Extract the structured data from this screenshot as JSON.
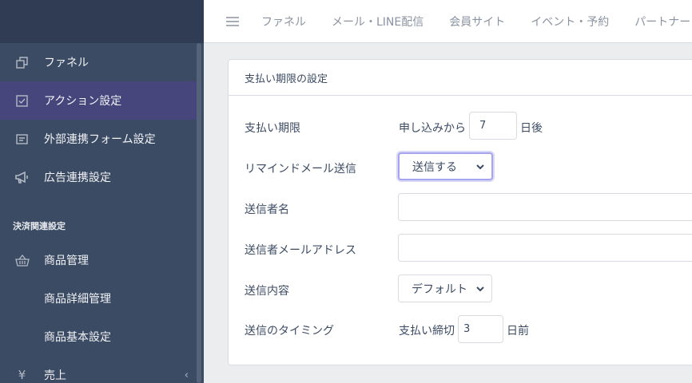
{
  "header": {
    "nav": [
      "ファネル",
      "メール・LINE配信",
      "会員サイト",
      "イベント・予約",
      "パートナー"
    ]
  },
  "sidebar": {
    "items": [
      {
        "label": "ファネル"
      },
      {
        "label": "アクション設定"
      },
      {
        "label": "外部連携フォーム設定"
      },
      {
        "label": "広告連携設定"
      }
    ],
    "section_title": "決済関連設定",
    "payment_items": [
      {
        "label": "商品管理"
      },
      {
        "label": "商品詳細管理"
      },
      {
        "label": "商品基本設定"
      },
      {
        "label": "売上"
      }
    ]
  },
  "card": {
    "title": "支払い期限の設定",
    "deadline": {
      "label": "支払い期限",
      "prefix": "申し込みから",
      "value": "7",
      "suffix": "日後"
    },
    "remind": {
      "label": "リマインドメール送信",
      "selected": "送信する"
    },
    "sender_name": {
      "label": "送信者名",
      "value": ""
    },
    "sender_email": {
      "label": "送信者メールアドレス",
      "value": ""
    },
    "content": {
      "label": "送信内容",
      "selected": "デフォルト"
    },
    "timing": {
      "label": "送信のタイミング",
      "prefix": "支払い締切",
      "value": "3",
      "suffix": "日前"
    }
  },
  "colors": {
    "sidebar": "#3c4b64",
    "active": "#46467c",
    "accent": "#a5a4ee"
  }
}
